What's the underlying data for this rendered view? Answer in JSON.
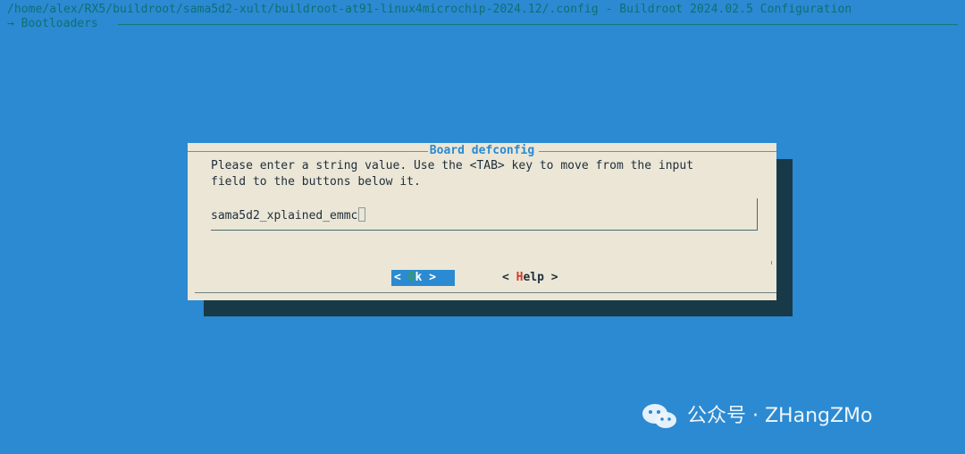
{
  "terminal": {
    "path_line": "/home/alex/RX5/buildroot/sama5d2-xult/buildroot-at91-linux4microchip-2024.12/.config - Buildroot 2024.02.5 Configuration",
    "breadcrumb": "→ Bootloaders"
  },
  "dialog": {
    "title": "Board defconfig",
    "message": "Please enter a string value. Use the <TAB> key to move from the input\nfield to the buttons below it.",
    "input_value": "sama5d2_xplained_emmc",
    "ok_prefix": "< ",
    "ok_hotkey": "O",
    "ok_suffix": "k >",
    "help_prefix": "< ",
    "help_hotkey": "H",
    "help_suffix": "elp >"
  },
  "watermark": {
    "text": "公众号 · ZHangZMo",
    "icon": "wechat-icon"
  },
  "colors": {
    "background": "#2b8ad2",
    "dialog": "#ebe6d6",
    "shadow": "#183947",
    "title": "#2b8ad2",
    "hotkey_ok": "#3aa146",
    "hotkey_help": "#d13b2a"
  }
}
